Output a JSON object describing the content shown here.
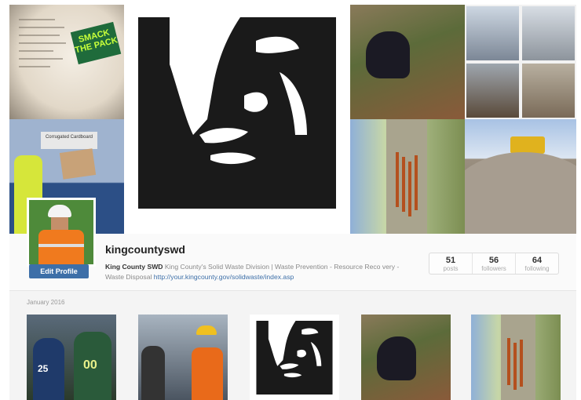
{
  "hero": {
    "sticker_text": "SMACK THE PACK",
    "sign_text": "Corrugated Cardboard"
  },
  "profile": {
    "username": "kingcountyswd",
    "edit_label": "Edit Profile",
    "bio_name": "King County SWD",
    "bio_text": " King County's Solid Waste Division | Waste Prevention - Resource Reco very - Waste Disposal ",
    "bio_link": "http://your.kingcounty.gov/solidwaste/index.asp",
    "stats": [
      {
        "num": "51",
        "label": "posts"
      },
      {
        "num": "56",
        "label": "followers"
      },
      {
        "num": "64",
        "label": "following"
      }
    ]
  },
  "feed": {
    "month_label": "January 2016",
    "thumbs": [
      "football-players-photo",
      "worker-speaking-photo",
      "face-logo-photo",
      "bear-photo",
      "clawed-tree-photo"
    ]
  },
  "colors": {
    "accent": "#3d6fa8",
    "background": "#3a3a3a"
  }
}
